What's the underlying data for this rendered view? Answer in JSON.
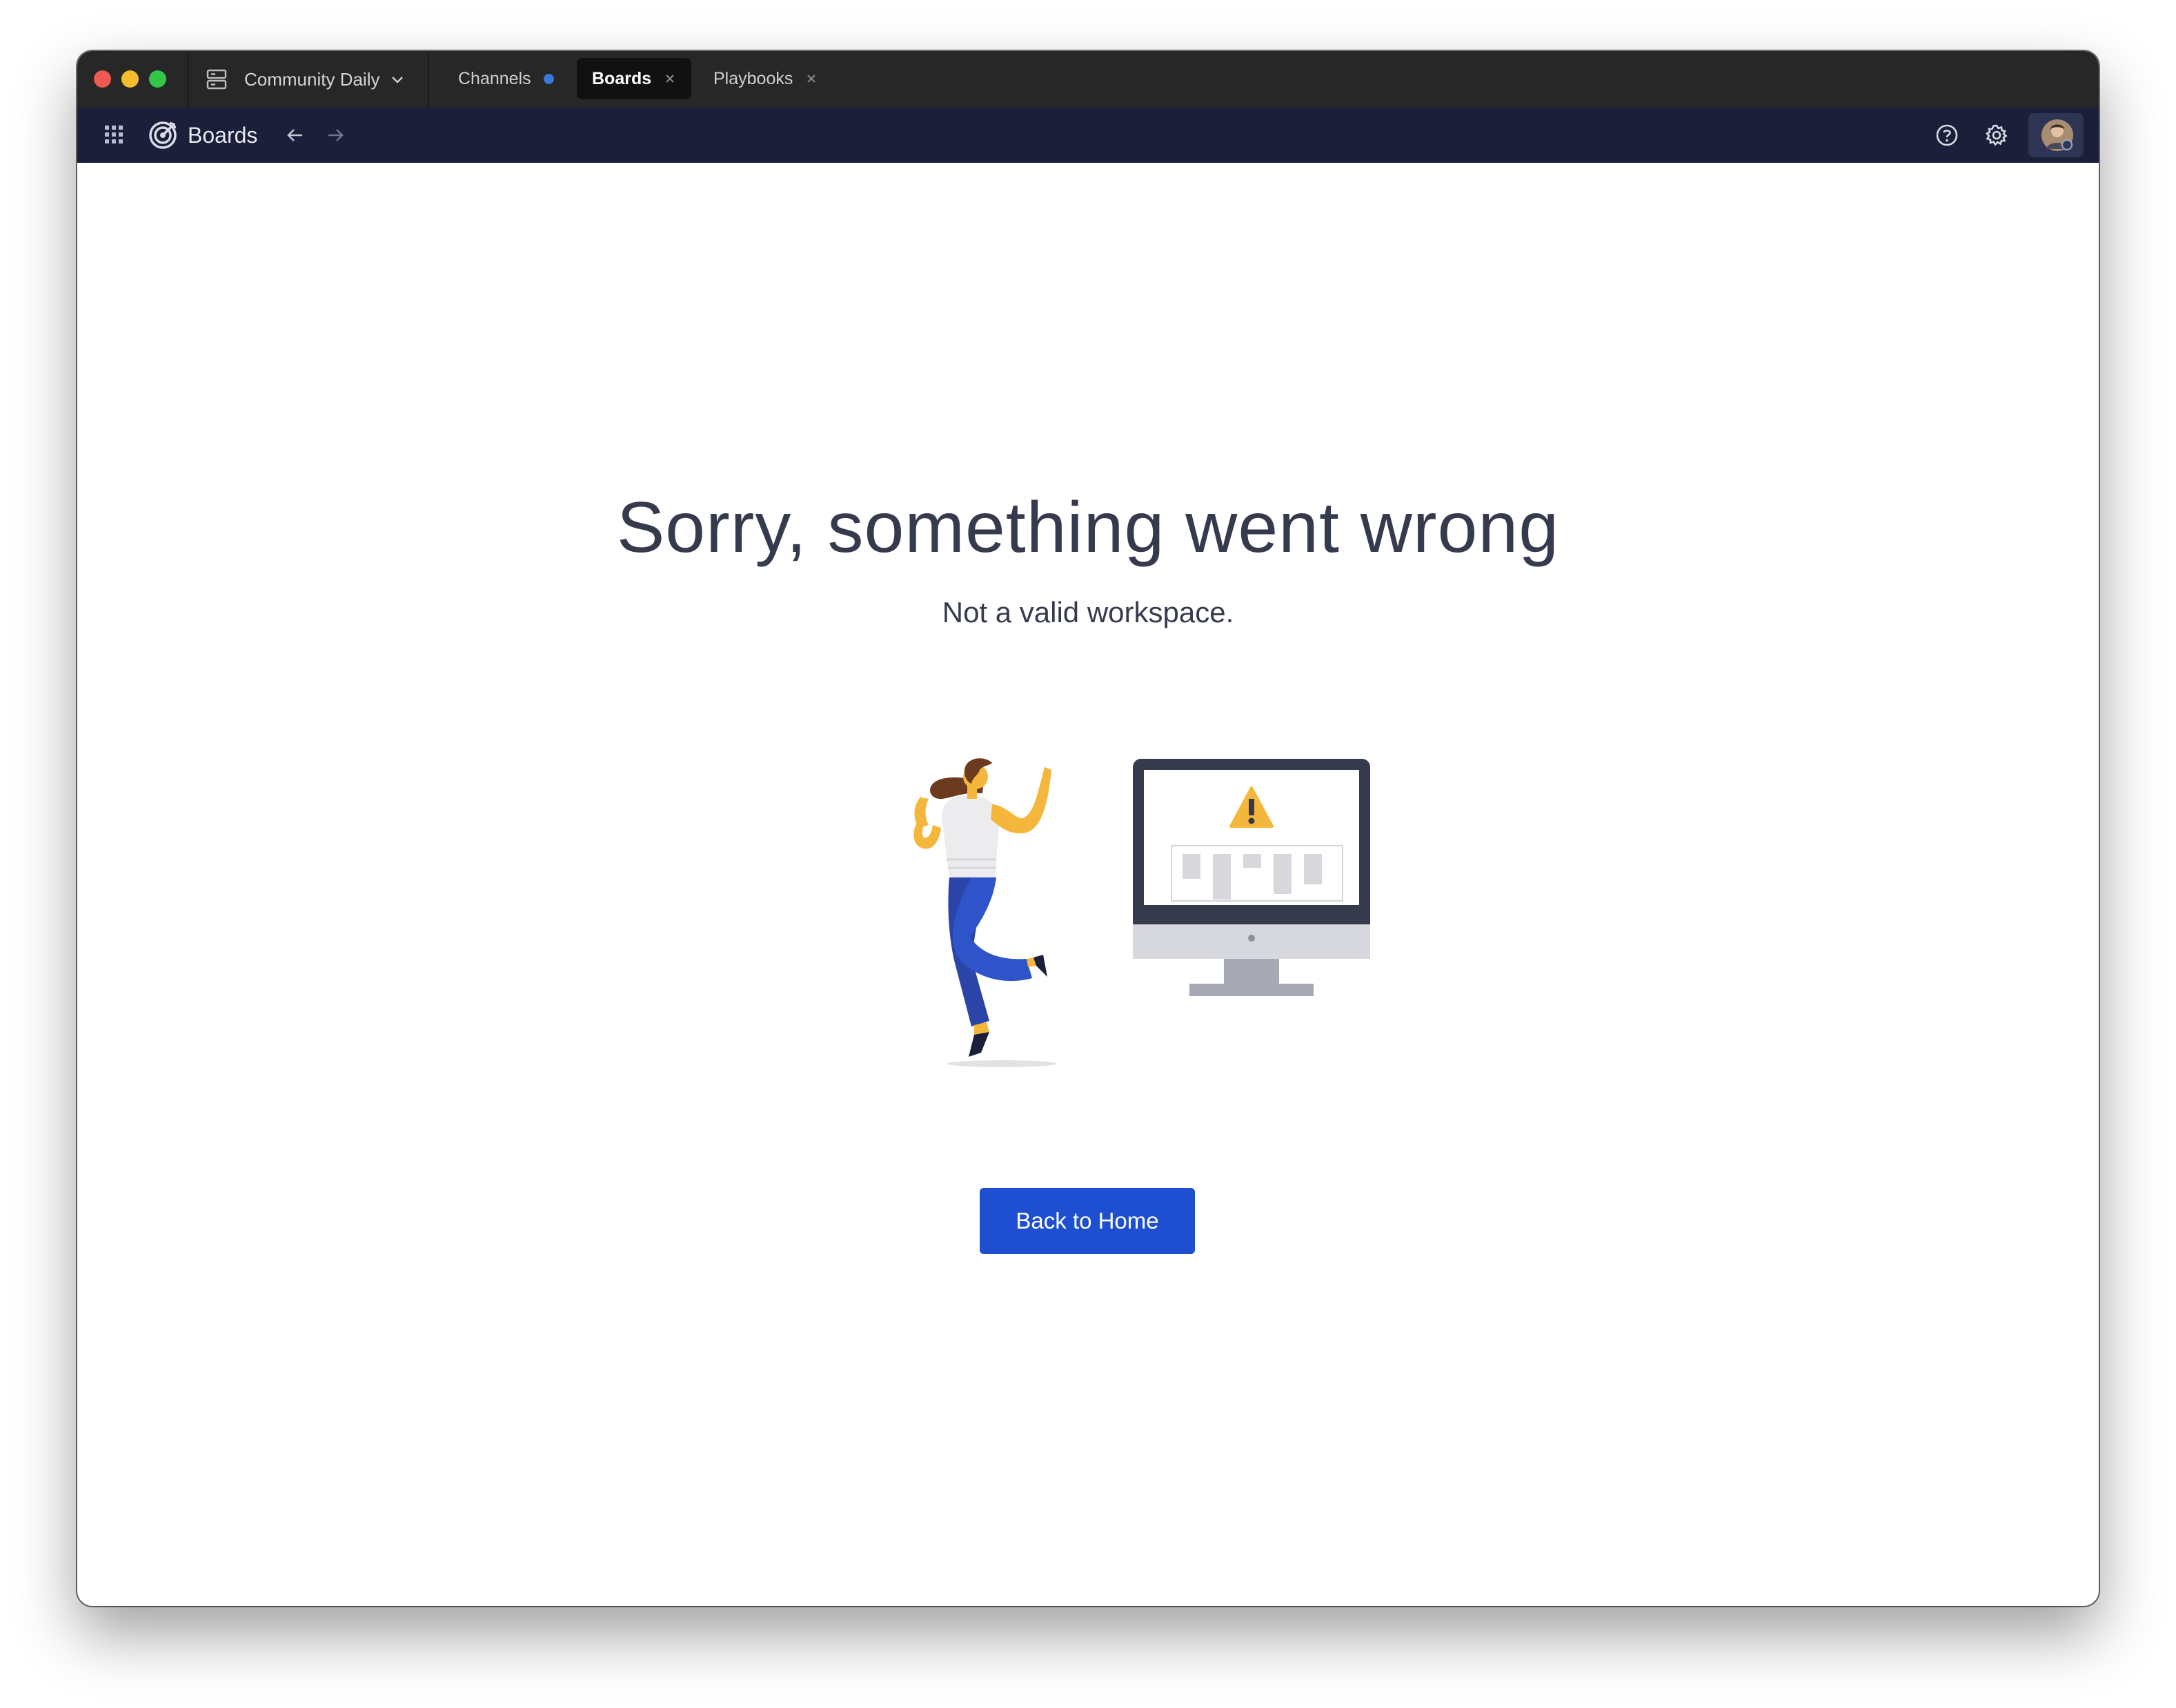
{
  "titlebar": {
    "server_name": "Community Daily",
    "tabs": [
      {
        "label": "Channels",
        "unread": true
      },
      {
        "label": "Boards",
        "active": true
      },
      {
        "label": "Playbooks"
      }
    ]
  },
  "header": {
    "product_name": "Boards"
  },
  "main": {
    "title": "Sorry, something went wrong",
    "subtitle": "Not a valid workspace.",
    "back_button_label": "Back to Home"
  },
  "icons": {
    "grid": "app-grid-icon",
    "logo": "boards-target-icon",
    "back": "arrow-left-icon",
    "forward": "arrow-right-icon",
    "help": "help-circle-icon",
    "settings": "gear-icon",
    "warning": "warning-triangle-icon"
  },
  "colors": {
    "titlebar": "#272727",
    "header": "#1b1f3a",
    "accent_button": "#1e4fd1",
    "heading_text": "#363a4d",
    "unread_dot": "#3b78d8"
  }
}
